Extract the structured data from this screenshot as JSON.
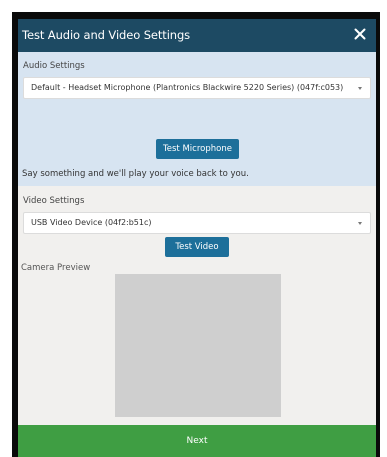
{
  "dialog": {
    "title": "Test Audio and Video Settings",
    "close_icon": "close-icon"
  },
  "audio": {
    "section_label": "Audio Settings",
    "selected_device": "Default - Headset Microphone (Plantronics Blackwire 5220 Series) (047f:c053)",
    "test_button": "Test Microphone",
    "hint": "Say something and we'll play your voice back to you."
  },
  "video": {
    "section_label": "Video Settings",
    "selected_device": "USB Video Device (04f2:b51c)",
    "test_button": "Test Video",
    "preview_label": "Camera Preview"
  },
  "footer": {
    "next_button": "Next"
  },
  "colors": {
    "header": "#1d4a63",
    "audio_panel": "#d7e4f1",
    "button": "#1d6f9a",
    "next": "#3f9e43",
    "preview": "#cfcfcf"
  }
}
